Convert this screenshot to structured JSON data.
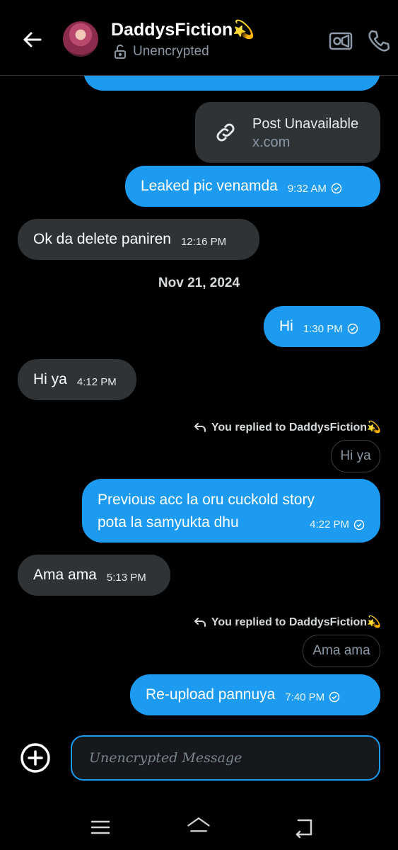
{
  "header": {
    "contact_name": "DaddysFiction💫",
    "status": "Unencrypted"
  },
  "link_card": {
    "title": "Post Unavailable",
    "domain": "x.com"
  },
  "messages": [
    {
      "text": "Leaked pic venamda",
      "time": "9:32 AM"
    },
    {
      "text": "Ok da delete paniren",
      "time": "12:16 PM"
    },
    {
      "text": "Hi",
      "time": "1:30 PM"
    },
    {
      "text": "Hi ya",
      "time": "4:12 PM"
    },
    {
      "reply_label": "You replied to DaddysFiction💫",
      "quoted": "Hi ya",
      "line1": "Previous acc la oru cuckold story",
      "line2": "pota la samyukta dhu",
      "time": "4:22 PM"
    },
    {
      "text": "Ama ama",
      "time": "5:13 PM"
    },
    {
      "reply_label": "You replied to DaddysFiction💫",
      "quoted": "Ama ama",
      "text": "Re-upload pannuya",
      "time": "7:40 PM"
    }
  ],
  "date_separator": "Nov 21, 2024",
  "composer": {
    "placeholder": "Unencrypted Message"
  },
  "colors": {
    "outgoing_bubble": "#1d9bf0",
    "incoming_bubble": "#2f3336",
    "background": "#000000"
  }
}
